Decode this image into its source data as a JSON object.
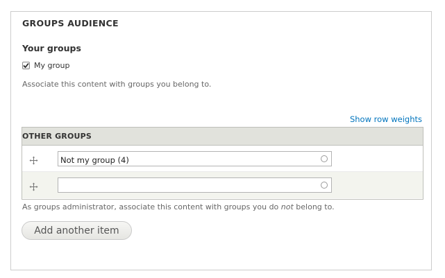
{
  "fieldset": {
    "legend": "GROUPS AUDIENCE"
  },
  "your_groups": {
    "title": "Your groups",
    "checkbox_label": "My group",
    "checked": true,
    "description": "Associate this content with groups you belong to."
  },
  "other_groups": {
    "show_row_weights": "Show row weights",
    "header": "OTHER GROUPS",
    "rows": [
      {
        "value": "Not my group (4)"
      },
      {
        "value": ""
      }
    ],
    "description_before": "As groups administrator, associate this content with groups you do ",
    "description_em": "not",
    "description_after": " belong to.",
    "add_button": "Add another item"
  },
  "colors": {
    "link": "#0074bd",
    "header_bg": "#e1e2dc",
    "even_row_bg": "#f3f4ee",
    "border": "#cccccc"
  },
  "icons": {
    "drag_handle": "move-cross-icon",
    "autocomplete": "autocomplete-throbber-icon",
    "checkmark": "checkmark-icon"
  }
}
